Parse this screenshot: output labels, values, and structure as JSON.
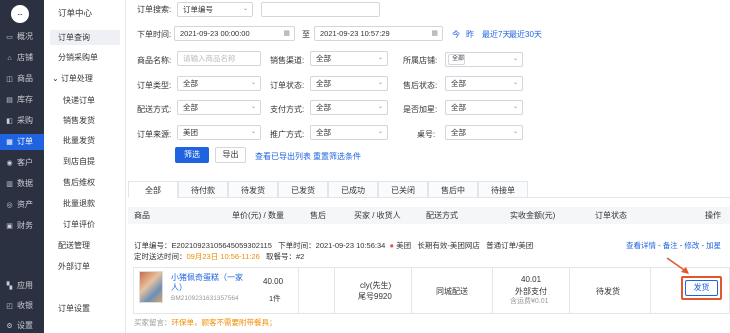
{
  "rail": {
    "logo": "...",
    "items": [
      {
        "icon": "overview-icon",
        "glyph": "▭",
        "label": "概况"
      },
      {
        "icon": "store-icon",
        "glyph": "⌂",
        "label": "店铺"
      },
      {
        "icon": "product-icon",
        "glyph": "◫",
        "label": "商品"
      },
      {
        "icon": "inventory-icon",
        "glyph": "▤",
        "label": "库存"
      },
      {
        "icon": "purchase-icon",
        "glyph": "◧",
        "label": "采购"
      },
      {
        "icon": "order-icon",
        "glyph": "▦",
        "label": "订单"
      },
      {
        "icon": "customer-icon",
        "glyph": "◉",
        "label": "客户"
      },
      {
        "icon": "data-icon",
        "glyph": "▥",
        "label": "数据"
      },
      {
        "icon": "asset-icon",
        "glyph": "◎",
        "label": "资产"
      },
      {
        "icon": "finance-icon",
        "glyph": "▣",
        "label": "财务"
      },
      {
        "icon": "apps-icon",
        "glyph": "▚",
        "label": "应用"
      },
      {
        "icon": "message-icon",
        "glyph": "◰",
        "label": "收银"
      },
      {
        "icon": "settings-icon",
        "glyph": "⚙",
        "label": "设置"
      }
    ]
  },
  "submenu": {
    "title": "订单中心",
    "order_query": "订单查询",
    "split_purchase": "分销采购单",
    "order_processing": "订单处理",
    "quick_order": "快递订单",
    "sales_ship": "销售发货",
    "batch_ship": "批量发货",
    "self_pickup": "到店自提",
    "after_sale": "售后维权",
    "batch_refund": "批量退款",
    "order_eval": "订单评价",
    "delivery_mgmt": "配送管理",
    "external_order": "外部订单",
    "order_settings": "订单设置"
  },
  "filters": {
    "search_label": "订单搜索:",
    "search_type": "订单编号",
    "order_time_label": "下单时间:",
    "time_start": "2021-09-23 00:00:00",
    "time_to": "至",
    "time_end": "2021-09-23 10:57:29",
    "quick_today": "今",
    "quick_yesterday": "昨",
    "quick_7": "最近7天",
    "quick_30": "最近30天",
    "product_label": "商品名称:",
    "product_placeholder": "请输入商品名称",
    "channel_label": "销售渠道:",
    "channel_value": "全部",
    "store_label": "所属店铺:",
    "store_value": "全部",
    "type_label": "订单类型:",
    "type_value": "全部",
    "status_label": "订单状态:",
    "status_value": "全部",
    "aftersale_label": "售后状态:",
    "aftersale_value": "全部",
    "delivery_label": "配送方式:",
    "delivery_value": "全部",
    "pay_label": "支付方式:",
    "pay_value": "全部",
    "rush_label": "是否加星:",
    "rush_value": "全部",
    "source_label": "订单来源:",
    "source_value": "美团",
    "promo_label": "推广方式:",
    "promo_value": "全部",
    "table_label": "桌号:",
    "table_value": "全部",
    "filter_btn": "筛选",
    "export_btn": "导出",
    "view_export": "查看已导出列表",
    "reset": "重置筛选条件"
  },
  "tabs": [
    "全部",
    "待付款",
    "待发货",
    "已发货",
    "已成功",
    "已关闭",
    "售后中",
    "待接单"
  ],
  "table": {
    "headers": {
      "product": "商品",
      "price_qty": "单价(元) / 数量",
      "aftersale": "售后",
      "buyer": "买家 / 收货人",
      "delivery": "配送方式",
      "amount": "实收金额(元)",
      "status": "订单状态",
      "action": "操作"
    }
  },
  "order": {
    "number_label": "订单编号：",
    "number": "E20210923105645059302115",
    "time_label": "下单时间：",
    "time": "2021-09-23 10:56:34",
    "dot": "●",
    "source": "美团",
    "store": "长期有效-美团网店",
    "type": "普通订单/美团",
    "links": {
      "detail": "查看详情",
      "remark": "备注",
      "modify": "修改",
      "star": "加星"
    },
    "sep": "-",
    "arrival_label": "定时送达时间：",
    "arrival": "09月23日 10:56-11:26",
    "pickup_label": "取餐号：",
    "pickup": "#2",
    "product_name": "小猪佩奇蛋糕（一家人）",
    "product_code": "BM2109231631357564",
    "price": "40.00",
    "qty": "1件",
    "buyer_name": "cly(先生)",
    "buyer_tail": "尾号9920",
    "delivery_method": "同城配送",
    "amount": "40.01",
    "pay_type": "外部支付",
    "fee": "含运费¥0.01",
    "status": "待发货",
    "ship_btn": "发货",
    "note_label": "买家留言：",
    "note": "环保单，顾客不需要附带餐具；"
  }
}
